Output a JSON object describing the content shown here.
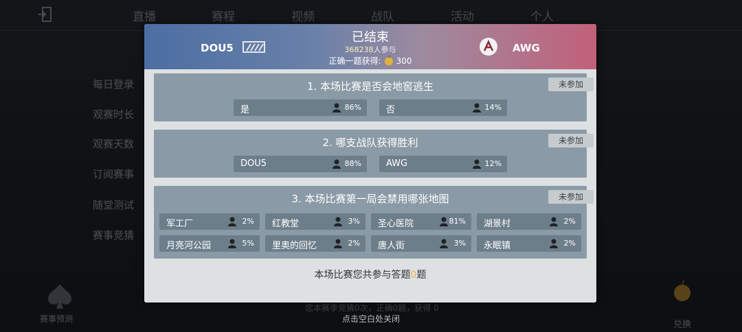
{
  "nav": [
    "直播",
    "赛程",
    "视频",
    "战队",
    "活动",
    "个人"
  ],
  "sidebar": [
    "每日登录",
    "观赛时长",
    "观赛天数",
    "订阅赛事",
    "随堂测试",
    "赛事竞猜"
  ],
  "bottom_left_label": "赛事预测",
  "bottom_right_label": "兑换",
  "bottom_bg_text": "您本赛季竞猜0次，正确0题，获得",
  "bottom_bg_count": "0",
  "close_hint": "点击空白处关闭",
  "modal": {
    "status": "已结束",
    "participants_count": "368238",
    "participants_suffix": "人参与",
    "reward_prefix": "正确一题获得:",
    "reward_amount": "300",
    "team_left": "DOU5",
    "team_right": "AWG",
    "questions": [
      {
        "title": "1.  本场比赛是否会地窖逃生",
        "tag": "未参加",
        "options": [
          {
            "label": "是",
            "pct": "86%"
          },
          {
            "label": "否",
            "pct": "14%"
          }
        ]
      },
      {
        "title": "2.  哪支战队获得胜利",
        "tag": "未参加",
        "options": [
          {
            "label": "DOU5",
            "pct": "88%"
          },
          {
            "label": "AWG",
            "pct": "12%"
          }
        ]
      },
      {
        "title": "3.  本场比赛第一局会禁用哪张地图",
        "tag": "未参加",
        "options": [
          {
            "label": "军工厂",
            "pct": "2%"
          },
          {
            "label": "红教堂",
            "pct": "3%"
          },
          {
            "label": "圣心医院",
            "pct": "81%"
          },
          {
            "label": "湖景村",
            "pct": "2%"
          },
          {
            "label": "月亮河公园",
            "pct": "5%"
          },
          {
            "label": "里奥的回忆",
            "pct": "2%"
          },
          {
            "label": "唐人街",
            "pct": "3%"
          },
          {
            "label": "永眠镇",
            "pct": "2%"
          }
        ]
      }
    ],
    "footer_prefix": "本场比赛您共参与答题",
    "footer_count": "0",
    "footer_suffix": "题"
  }
}
